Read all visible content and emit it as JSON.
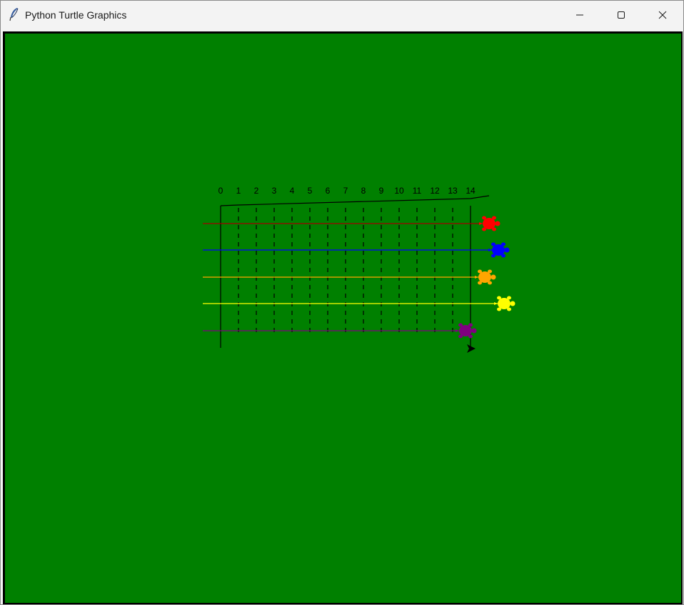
{
  "window": {
    "title": "Python Turtle Graphics",
    "minimize_icon": "minimize-icon",
    "maximize_icon": "maximize-icon",
    "close_icon": "close-icon",
    "app_icon": "feather-icon"
  },
  "canvas": {
    "background": "#008000",
    "track_labels": [
      "0",
      "1",
      "2",
      "3",
      "4",
      "5",
      "6",
      "7",
      "8",
      "9",
      "10",
      "11",
      "12",
      "13",
      "14"
    ]
  },
  "racers": [
    {
      "name": "red",
      "color": "#ff0000",
      "line_color": "#a00000"
    },
    {
      "name": "blue",
      "color": "#0000ff",
      "line_color": "#0000ff"
    },
    {
      "name": "orange",
      "color": "#ffa500",
      "line_color": "#ffa500"
    },
    {
      "name": "yellow",
      "color": "#ffff00",
      "line_color": "#ffff00"
    },
    {
      "name": "purple",
      "color": "#800080",
      "line_color": "#800080"
    }
  ]
}
